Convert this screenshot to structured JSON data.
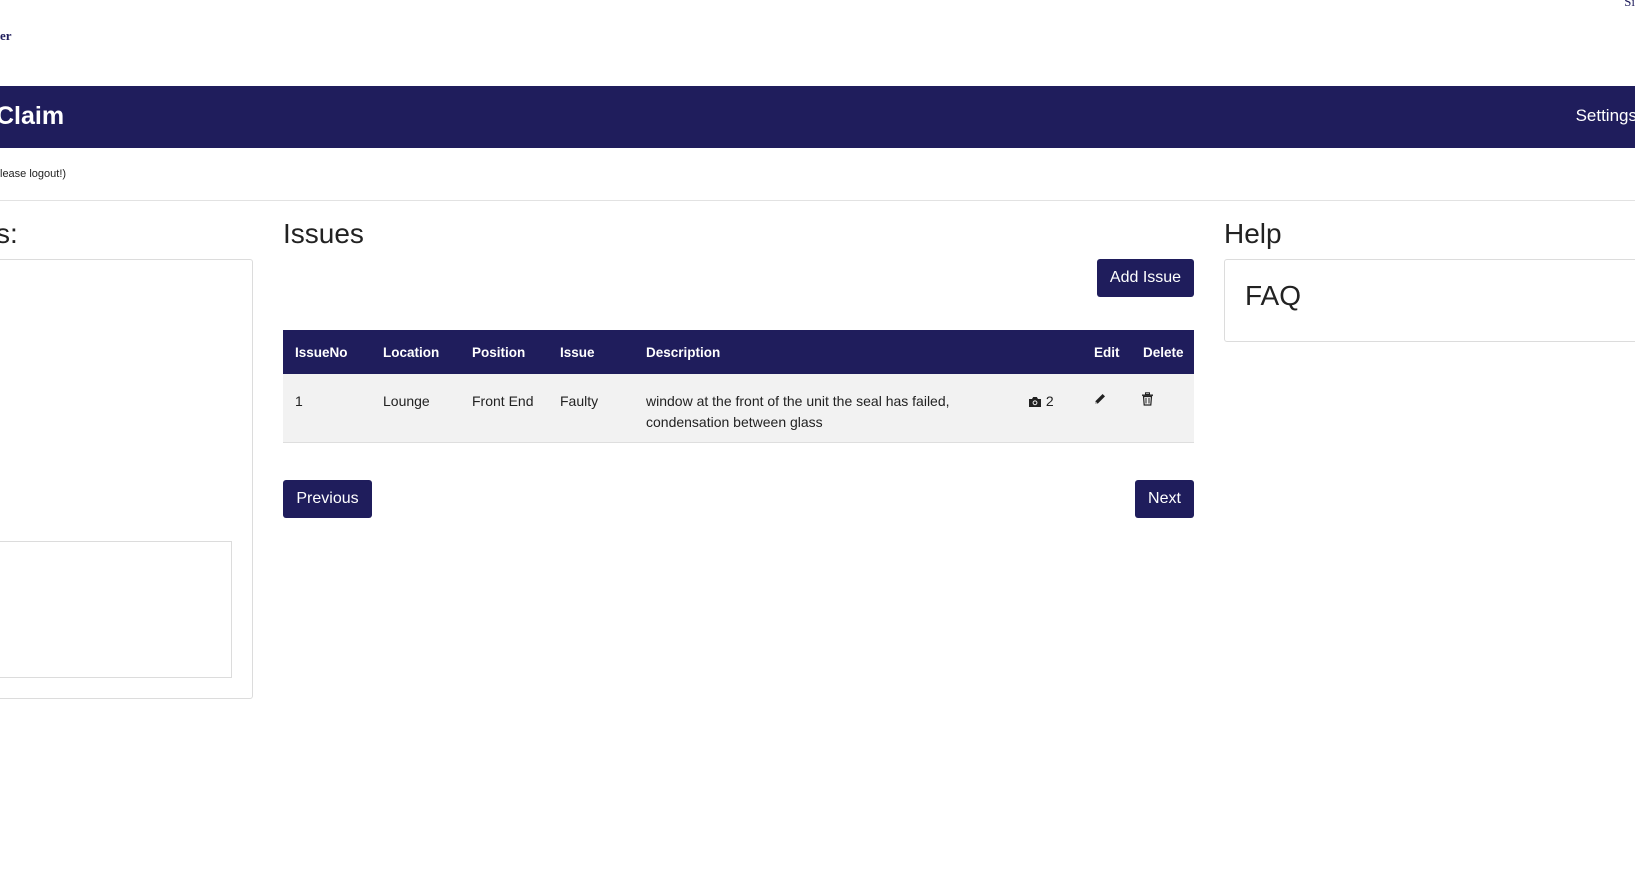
{
  "header": {
    "brand_fragment": "er",
    "signin_fragment": "Si",
    "app_title": "Claim",
    "settings_label": "Settings"
  },
  "notice": "lease logout!)",
  "left_panel": {
    "heading": "s:"
  },
  "issues": {
    "heading": "Issues",
    "add_button": "Add Issue",
    "columns": [
      "IssueNo",
      "Location",
      "Position",
      "Issue",
      "Description",
      "",
      "Edit",
      "Delete"
    ],
    "rows": [
      {
        "issue_no": "1",
        "location": "Lounge",
        "position": "Front End",
        "issue": "Faulty",
        "description": "window at the front of the unit the seal has failed, condensation between glass",
        "photo_count": "2"
      }
    ],
    "previous_label": "Previous",
    "next_label": "Next"
  },
  "help": {
    "heading": "Help",
    "faq_title": "FAQ"
  },
  "colors": {
    "primary": "#1f1d5c",
    "row_bg": "#f2f2f2"
  },
  "icons": [
    "camera-icon",
    "pencil-icon",
    "trash-icon"
  ]
}
